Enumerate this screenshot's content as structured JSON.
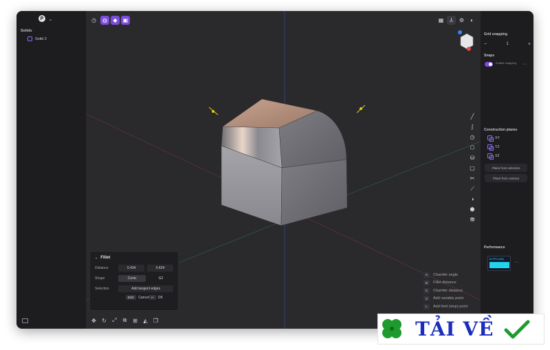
{
  "left_panel": {
    "avatar_letter": "P",
    "solids_label": "Solids",
    "solid_item": "Solid 2"
  },
  "fillet": {
    "title": "Fillet",
    "distance_label": "Distance",
    "distance_a": "0.434",
    "distance_b": "0.434",
    "shape_label": "Shape",
    "shape_a": "Conic",
    "shape_b": "G2",
    "selection_label": "Selection",
    "selection_button": "Add tangent edges",
    "cancel_key": "ESC",
    "cancel_label": "Cancel",
    "ok_key": "↩",
    "ok_label": "OK"
  },
  "shortcuts": [
    {
      "key": "A",
      "label": "Chamfer angle"
    },
    {
      "key": "D",
      "label": "Fillet distance"
    },
    {
      "key": "C",
      "label": "Chamfer distance"
    },
    {
      "key": "V",
      "label": "Add variable point"
    },
    {
      "key": "L",
      "label": "Add limit (stop) point"
    }
  ],
  "right_panel": {
    "grid_label": "Grid snapping",
    "grid_minus": "−",
    "grid_value": "1",
    "grid_plus": "+",
    "snaps_label": "Snaps",
    "snap_toggle_text": "Enable snapping",
    "construction_label": "Construction planes",
    "planes": [
      "XY",
      "YZ",
      "XZ"
    ],
    "plane_from_selection": "Plane from selection",
    "plane_from_camera": "Plane from camera",
    "performance_label": "Performance",
    "fps_text": "60 FPS (h60)"
  },
  "watermark": {
    "text": "TẢI VỀ"
  },
  "colors": {
    "accent": "#7c4ddb",
    "viewport_bg": "#2a2a2d",
    "panel_bg": "#1d1d20"
  }
}
